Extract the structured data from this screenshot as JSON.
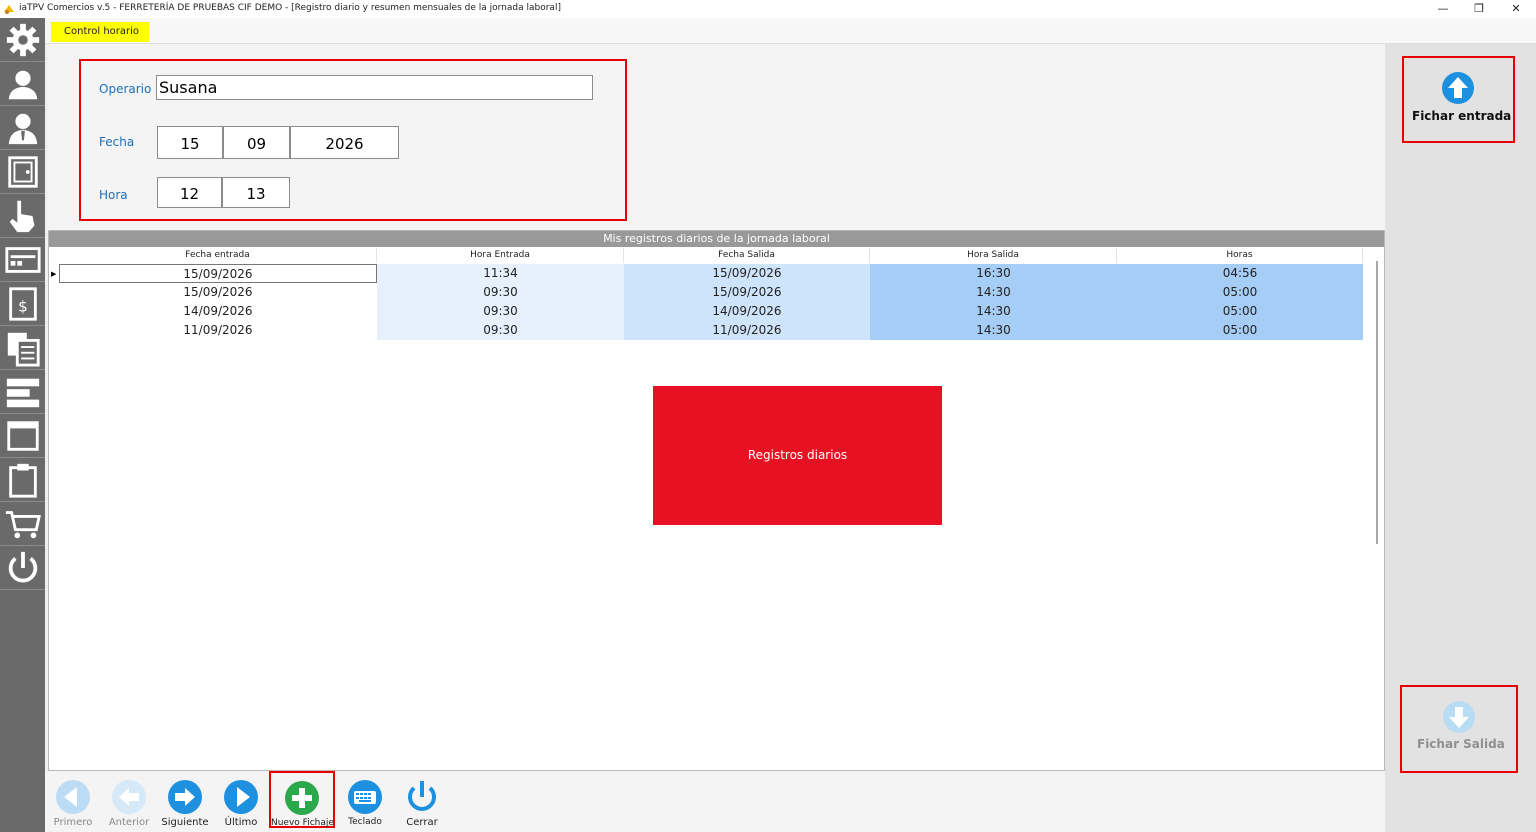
{
  "window": {
    "title": "iaTPV Comercios v.5 - FERRETERÍA DE PRUEBAS CIF DEMO - [Registro diario y resumen mensuales de la jornada laboral]",
    "minimize": "—",
    "restore": "❐",
    "close": "✕"
  },
  "tab": {
    "label": "Control horario"
  },
  "form": {
    "operario_label": "Operario",
    "operario_value": "Susana",
    "fecha_label": "Fecha",
    "fecha_day": "15",
    "fecha_month": "09",
    "fecha_year": "2026",
    "hora_label": "Hora",
    "hora_h": "12",
    "hora_m": "13"
  },
  "grid": {
    "title": "Mis registros diarios de la jornada laboral",
    "columns": [
      "Fecha entrada",
      "Hora Entrada",
      "Fecha Salida",
      "Hora Salida",
      "Horas"
    ],
    "rows": [
      [
        "15/09/2026",
        "11:34",
        "15/09/2026",
        "16:30",
        "04:56"
      ],
      [
        "15/09/2026",
        "09:30",
        "15/09/2026",
        "14:30",
        "05:00"
      ],
      [
        "14/09/2026",
        "09:30",
        "14/09/2026",
        "14:30",
        "05:00"
      ],
      [
        "11/09/2026",
        "09:30",
        "11/09/2026",
        "14:30",
        "05:00"
      ]
    ]
  },
  "panel": {
    "label": "Registros diarios"
  },
  "actions": {
    "entrada_label": "Fichar entrada",
    "salida_label": "Fichar Salida"
  },
  "toolbar": {
    "primero": "Primero",
    "anterior": "Anterior",
    "siguiente": "Siguiente",
    "ultimo": "Último",
    "nuevo": "Nuevo Fichaje",
    "teclado": "Teclado",
    "cerrar": "Cerrar"
  },
  "colors": {
    "accent": "#1e90e0",
    "highlight": "#e60000",
    "tab": "#ffff00",
    "add": "#2aa84a"
  },
  "sidebar_icons": [
    "gear-icon",
    "customer-icon",
    "employee-icon",
    "safe-icon",
    "hand-pointer-icon",
    "pos-terminal-icon",
    "price-document-icon",
    "documents-icon",
    "add-item-icon",
    "window-icon",
    "clipboard-icon",
    "cart-icon",
    "power-icon"
  ]
}
